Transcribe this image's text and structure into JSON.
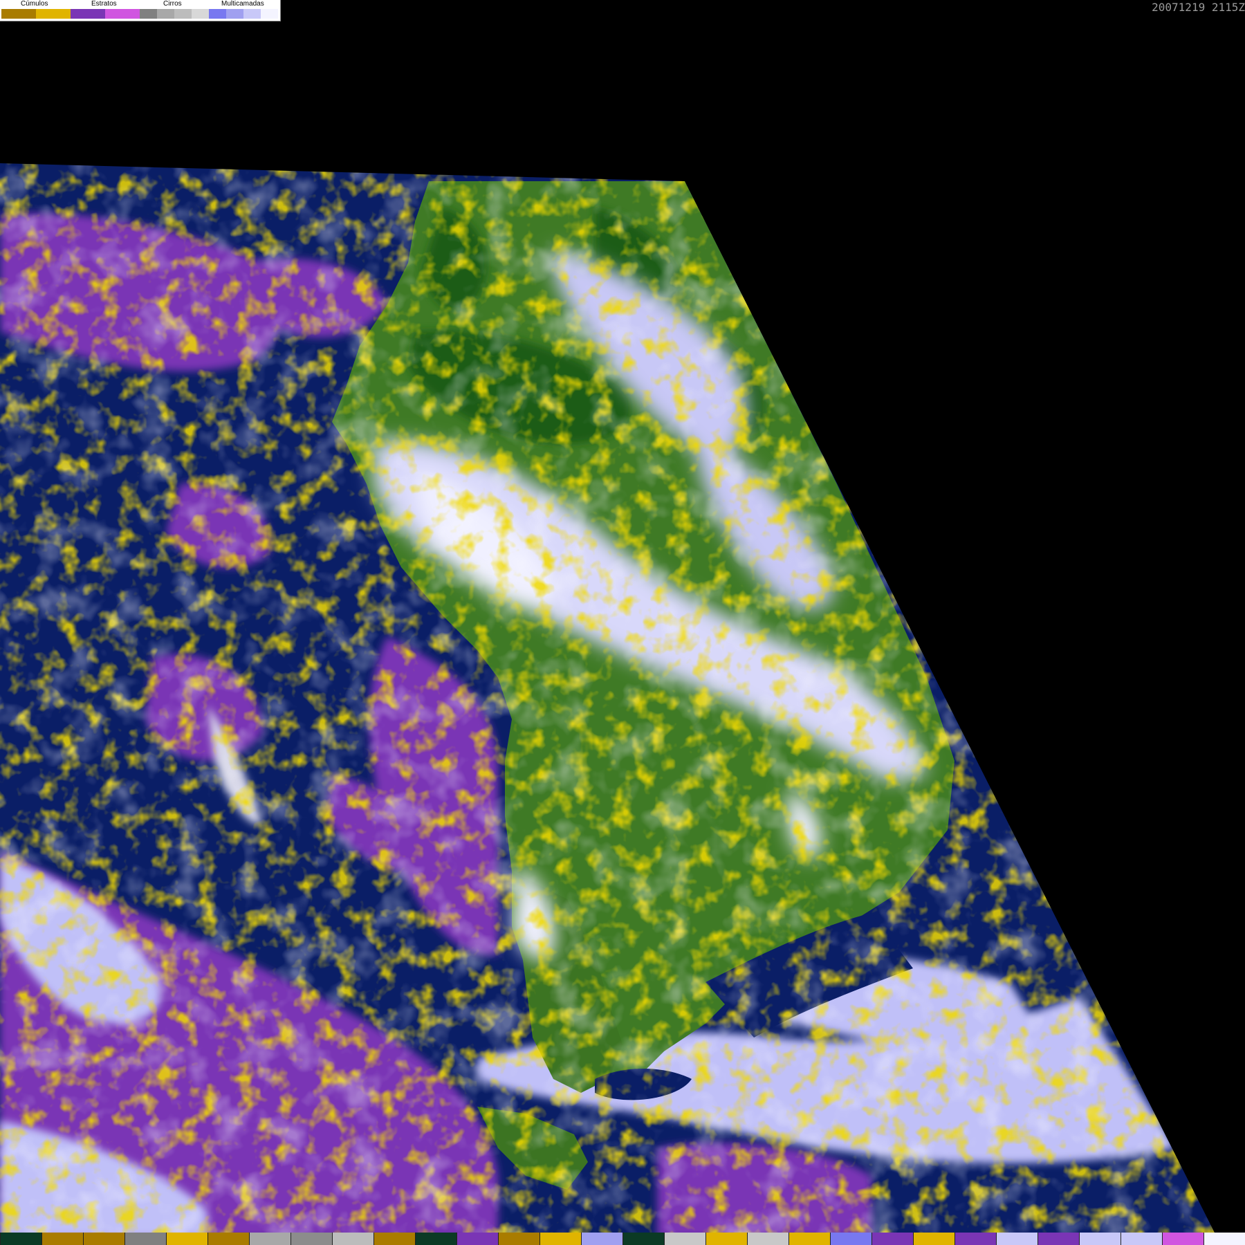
{
  "timestamp": "20071219 2115Z",
  "legend": {
    "labels": [
      "Cúmulos",
      "Estratos",
      "Cirros",
      "Multicamadas"
    ],
    "swatches": [
      "#a97c00",
      "#e0b400",
      "#7a35b5",
      "#d055e0",
      "#808080",
      "#a8a8a8",
      "#bcbcbc",
      "#d8d8d8",
      "#7878f0",
      "#a0a0f0",
      "#c8c8f8",
      "#f4f4ff"
    ]
  },
  "colors": {
    "space": "#000000",
    "ocean": "#0a1e66",
    "land": "#3f7a25",
    "forest": "#1f5c12",
    "cumulus_brown": "#a97c00",
    "cumulus_yellow": "#e0b400",
    "stratus_purple": "#7a35b5",
    "stratus_magenta": "#d055e0",
    "cirrus_grey": "#a8a8a8",
    "multilayer_lavender": "#c0c0f8",
    "multilayer_white": "#f0f0ff"
  },
  "bottom_bar": [
    "#0b3a25",
    "#a97c00",
    "#a97c00",
    "#808080",
    "#e0b400",
    "#a97c00",
    "#a8a8a8",
    "#8c8c8c",
    "#bcbcbc",
    "#a97c00",
    "#0b3a25",
    "#7a35b5",
    "#a97c00",
    "#e0b400",
    "#a0a0f0",
    "#0b3a25",
    "#c8c8c8",
    "#e0b400",
    "#c8c8c8",
    "#e0b400",
    "#7878f0",
    "#7a35b5",
    "#e0b400",
    "#7a35b5",
    "#c8c8f8",
    "#7a35b5",
    "#c8c8f8",
    "#c8c8f8",
    "#d055e0",
    "#f4f4ff"
  ]
}
